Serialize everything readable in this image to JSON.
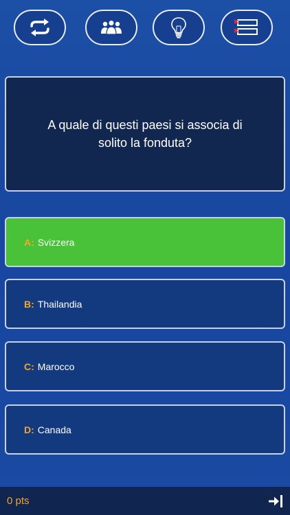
{
  "lifelines": [
    {
      "icon": "swap-arrows-icon",
      "label": "Switch question"
    },
    {
      "icon": "audience-icon",
      "label": "Ask the audience"
    },
    {
      "icon": "lightbulb-icon",
      "label": "Hint"
    },
    {
      "icon": "fifty-fifty-list-icon",
      "label": "Remove answers"
    }
  ],
  "question": {
    "text": "A quale di questi paesi si associa di solito la fonduta?"
  },
  "answers": [
    {
      "letter": "A:",
      "text": "Svizzera",
      "state": "correct"
    },
    {
      "letter": "B:",
      "text": "Thailandia",
      "state": "default"
    },
    {
      "letter": "C:",
      "text": "Marocco",
      "state": "default"
    },
    {
      "letter": "D:",
      "text": "Canada",
      "state": "default"
    }
  ],
  "footer": {
    "score": "0 pts",
    "exit_icon": "exit-arrow-icon"
  },
  "colors": {
    "background": "#1c4fa6",
    "question_bg": "#12274f",
    "answer_bg": "#133a7e",
    "correct": "#49c23a",
    "accent": "#f5a623"
  }
}
